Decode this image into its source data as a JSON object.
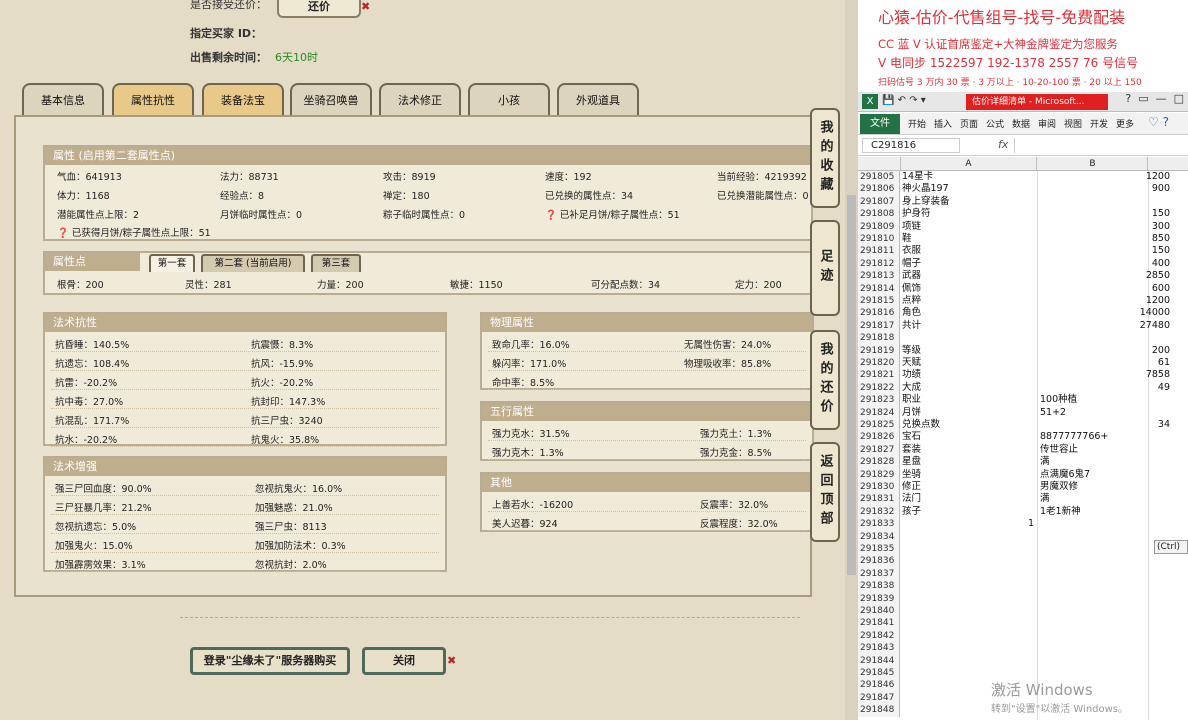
{
  "top_info": {
    "accept_bargain_label": "是否接受还价：",
    "bargain_button": "还价",
    "buyer_id_label": "指定买家 ID：",
    "remaining_label": "出售剩余时间：",
    "remaining_value": "6天10时"
  },
  "tabs": [
    "基本信息",
    "属性抗性",
    "装备法宝",
    "坐骑召唤兽",
    "法术修正",
    "小孩",
    "外观道具"
  ],
  "attr": {
    "title": "属性 (启用第二套属性点)",
    "rows": [
      [
        "气血：641913",
        "法力：88731",
        "攻击：8919",
        "速度：192",
        "当前经验：4219392"
      ],
      [
        "体力：1168",
        "经验点：8",
        "禅定：180",
        "已兑换的属性点：34",
        "已兑换潜能属性点：0"
      ],
      [
        "潜能属性点上限：2",
        "月饼临时属性点：0",
        "粽子临时属性点：0",
        "已补足月饼/粽子属性点：51",
        ""
      ],
      [
        "已获得月饼/粽子属性点上限：51",
        "",
        "",
        "",
        ""
      ]
    ]
  },
  "points": {
    "title": "属性点",
    "sub_tabs": [
      "第一套",
      "第二套 (当前启用)",
      "第三套"
    ],
    "values": [
      "根骨：200",
      "灵性：281",
      "力量：200",
      "敏捷：1150",
      "可分配点数：34",
      "定力：200"
    ]
  },
  "resist": {
    "title": "法术抗性",
    "rows": [
      [
        "抗昏睡：140.5%",
        "抗震慑：8.3%"
      ],
      [
        "抗遗忘：108.4%",
        "抗风：-15.9%"
      ],
      [
        "抗雷：-20.2%",
        "抗火：-20.2%"
      ],
      [
        "抗中毒：27.0%",
        "抗封印：147.3%"
      ],
      [
        "抗混乱：171.7%",
        "抗三尸虫：3240"
      ],
      [
        "抗水：-20.2%",
        "抗鬼火：35.8%"
      ]
    ]
  },
  "enhance": {
    "title": "法术增强",
    "rows": [
      [
        "强三尸回血度：90.0%",
        "忽视抗鬼火：16.0%"
      ],
      [
        "三尸狂暴几率：21.2%",
        "加强魅惑：21.0%"
      ],
      [
        "忽视抗遗忘：5.0%",
        "强三尸虫：8113"
      ],
      [
        "加强鬼火：15.0%",
        "加强加防法术：0.3%"
      ],
      [
        "加强霹雳效果：3.1%",
        "忽视抗封：2.0%"
      ]
    ]
  },
  "physical": {
    "title": "物理属性",
    "rows": [
      [
        "致命几率：16.0%",
        "无属性伤害：24.0%"
      ],
      [
        "躲闪率：171.0%",
        "物理吸收率：85.8%"
      ],
      [
        "命中率：8.5%",
        ""
      ]
    ]
  },
  "wuxing": {
    "title": "五行属性",
    "rows": [
      [
        "强力克水：31.5%",
        "强力克土：1.3%"
      ],
      [
        "强力克木：1.3%",
        "强力克金：8.5%"
      ]
    ]
  },
  "other": {
    "title": "其他",
    "rows": [
      [
        "上善若水：-16200",
        "反震率：32.0%"
      ],
      [
        "美人迟暮：924",
        "反震程度：32.0%"
      ]
    ]
  },
  "side_buttons": [
    "我的收藏",
    "足迹",
    "我的还价",
    "返回顶部"
  ],
  "bottom": {
    "login_button": "登录\"尘缘未了\"服务器购买",
    "close_button": "关闭"
  },
  "ad": {
    "line1": "心猿-估价-代售组号-找号-免费配装",
    "line2": "CC 蓝 V 认证首席鉴定+大神金牌鉴定为您服务",
    "line3": "V 电同步 1522597 192-1378 2557 76 号信号",
    "line4": "扫码估号 3 万内 30 票 · 3 万以上 · 10-20-100 票 · 20 以上 150"
  },
  "excel": {
    "window_title": "估价详细清单 - Microsoft...",
    "ribbon_tabs": [
      "文件",
      "开始",
      "插入",
      "页面",
      "公式",
      "数据",
      "审阅",
      "视图",
      "开发",
      "更多"
    ],
    "name_box": "C291816",
    "fx": "fx",
    "col_a": "A",
    "col_b": "B",
    "rows": [
      {
        "n": "291805",
        "a": "14星卡",
        "b": "1200",
        "t": "num"
      },
      {
        "n": "291806",
        "a": "神火晶197",
        "b": "900",
        "t": "num"
      },
      {
        "n": "291807",
        "a": "身上穿装备",
        "b": "",
        "t": "num"
      },
      {
        "n": "291808",
        "a": "护身符",
        "b": "150",
        "t": "num"
      },
      {
        "n": "291809",
        "a": "项链",
        "b": "300",
        "t": "num"
      },
      {
        "n": "291810",
        "a": "鞋",
        "b": "850",
        "t": "num"
      },
      {
        "n": "291811",
        "a": "衣服",
        "b": "150",
        "t": "num"
      },
      {
        "n": "291812",
        "a": "帽子",
        "b": "400",
        "t": "num"
      },
      {
        "n": "291813",
        "a": "武器",
        "b": "2850",
        "t": "num"
      },
      {
        "n": "291814",
        "a": "佩饰",
        "b": "600",
        "t": "num"
      },
      {
        "n": "291815",
        "a": "点粹",
        "b": "1200",
        "t": "num"
      },
      {
        "n": "291816",
        "a": "角色",
        "b": "14000",
        "t": "num"
      },
      {
        "n": "291817",
        "a": "共计",
        "b": "27480",
        "t": "num"
      },
      {
        "n": "291818",
        "a": "",
        "b": "",
        "t": "num"
      },
      {
        "n": "291819",
        "a": "等级",
        "b": "200",
        "t": "num"
      },
      {
        "n": "291820",
        "a": "天赋",
        "b": "61",
        "t": "num"
      },
      {
        "n": "291821",
        "a": "功绩",
        "b": "7858",
        "t": "num"
      },
      {
        "n": "291822",
        "a": "大成",
        "b": "49",
        "t": "num"
      },
      {
        "n": "291823",
        "a": "职业",
        "b": "100种植",
        "t": "txt"
      },
      {
        "n": "291824",
        "a": "月饼",
        "b": "51+2",
        "t": "txt"
      },
      {
        "n": "291825",
        "a": "兑换点数",
        "b": "34",
        "t": "num"
      },
      {
        "n": "291826",
        "a": "宝石",
        "b": "8877777766+",
        "t": "txt"
      },
      {
        "n": "291827",
        "a": "套装",
        "b": "传世容止",
        "t": "txt"
      },
      {
        "n": "291828",
        "a": "星盘",
        "b": "满",
        "t": "txt"
      },
      {
        "n": "291829",
        "a": "坐骑",
        "b": "点满魔6鬼7",
        "t": "txt"
      },
      {
        "n": "291830",
        "a": "修正",
        "b": "男魔双修",
        "t": "txt"
      },
      {
        "n": "291831",
        "a": "法门",
        "b": "满",
        "t": "txt"
      },
      {
        "n": "291832",
        "a": "孩子",
        "b": "1老1新神",
        "t": "txt"
      },
      {
        "n": "291833",
        "a": "1",
        "b": "",
        "t": "num"
      },
      {
        "n": "291834",
        "a": "",
        "b": "",
        "t": "num"
      },
      {
        "n": "291835",
        "a": "",
        "b": "",
        "t": "num"
      },
      {
        "n": "291836",
        "a": "",
        "b": "",
        "t": "num"
      },
      {
        "n": "291837",
        "a": "",
        "b": "",
        "t": "num"
      },
      {
        "n": "291838",
        "a": "",
        "b": "",
        "t": "num"
      },
      {
        "n": "291839",
        "a": "",
        "b": "",
        "t": "num"
      },
      {
        "n": "291840",
        "a": "",
        "b": "",
        "t": "num"
      },
      {
        "n": "291841",
        "a": "",
        "b": "",
        "t": "num"
      },
      {
        "n": "291842",
        "a": "",
        "b": "",
        "t": "num"
      },
      {
        "n": "291843",
        "a": "",
        "b": "",
        "t": "num"
      },
      {
        "n": "291844",
        "a": "",
        "b": "",
        "t": "num"
      },
      {
        "n": "291845",
        "a": "",
        "b": "",
        "t": "num"
      },
      {
        "n": "291846",
        "a": "",
        "b": "",
        "t": "num"
      },
      {
        "n": "291847",
        "a": "",
        "b": "",
        "t": "num"
      },
      {
        "n": "291848",
        "a": "",
        "b": "",
        "t": "num"
      }
    ],
    "paste_tip": "(Ctrl)"
  },
  "windows_activate": {
    "line1": "激活 Windows",
    "line2": "转到\"设置\"以激活 Windows。"
  }
}
